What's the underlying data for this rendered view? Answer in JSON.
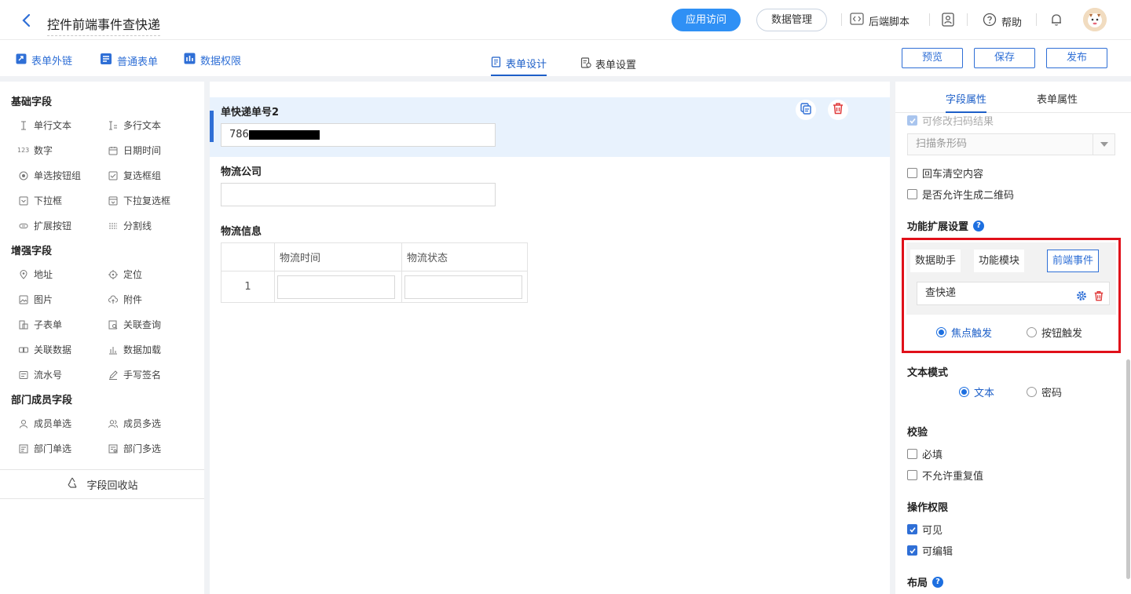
{
  "header": {
    "title": "控件前端事件查快递",
    "app_access_label": "应用访问",
    "data_manage_label": "数据管理",
    "backend_script_label": "后端脚本",
    "help_label": "帮助"
  },
  "subnav": {
    "form_link_label": "表单外链",
    "normal_form_label": "普通表单",
    "data_permission_label": "数据权限",
    "tabs": [
      {
        "label": "表单设计",
        "active": true
      },
      {
        "label": "表单设置",
        "active": false
      }
    ],
    "preview_label": "预览",
    "save_label": "保存",
    "publish_label": "发布"
  },
  "left_panel": {
    "sections": [
      {
        "title": "基础字段",
        "items": [
          {
            "label": "单行文本",
            "icon": "single-text-icon"
          },
          {
            "label": "多行文本",
            "icon": "multi-text-icon"
          },
          {
            "label": "数字",
            "icon": "number-icon"
          },
          {
            "label": "日期时间",
            "icon": "calendar-icon"
          },
          {
            "label": "单选按钮组",
            "icon": "radio-icon"
          },
          {
            "label": "复选框组",
            "icon": "checkbox-icon"
          },
          {
            "label": "下拉框",
            "icon": "dropdown-icon"
          },
          {
            "label": "下拉复选框",
            "icon": "dropdown-multi-icon"
          },
          {
            "label": "扩展按钮",
            "icon": "ext-button-icon"
          },
          {
            "label": "分割线",
            "icon": "divider-icon"
          }
        ]
      },
      {
        "title": "增强字段",
        "items": [
          {
            "label": "地址",
            "icon": "location-pin-icon"
          },
          {
            "label": "定位",
            "icon": "crosshair-icon"
          },
          {
            "label": "图片",
            "icon": "image-icon"
          },
          {
            "label": "附件",
            "icon": "cloud-upload-icon"
          },
          {
            "label": "子表单",
            "icon": "subform-icon"
          },
          {
            "label": "关联查询",
            "icon": "link-query-icon"
          },
          {
            "label": "关联数据",
            "icon": "link-data-icon"
          },
          {
            "label": "数据加载",
            "icon": "bar-chart-icon"
          },
          {
            "label": "流水号",
            "icon": "serial-icon"
          },
          {
            "label": "手写签名",
            "icon": "pen-icon"
          }
        ]
      },
      {
        "title": "部门成员字段",
        "items": [
          {
            "label": "成员单选",
            "icon": "user-icon"
          },
          {
            "label": "成员多选",
            "icon": "users-icon"
          },
          {
            "label": "部门单选",
            "icon": "dept-icon"
          },
          {
            "label": "部门多选",
            "icon": "dept-multi-icon"
          }
        ]
      }
    ],
    "recycle_label": "字段回收站"
  },
  "canvas": {
    "fields": [
      {
        "label": "单快递单号2",
        "value": "786"
      },
      {
        "label": "物流公司",
        "value": ""
      },
      {
        "label": "物流信息"
      }
    ],
    "table": {
      "headers": [
        "",
        "物流时间",
        "物流状态"
      ],
      "rows": [
        {
          "index": "1"
        }
      ]
    }
  },
  "right_panel": {
    "tabs": [
      {
        "label": "字段属性",
        "active": true
      },
      {
        "label": "表单属性",
        "active": false
      }
    ],
    "scan_editable_label": "可修改扫码结果",
    "scan_select_value": "扫描条形码",
    "enter_clear_label": "回车清空内容",
    "allow_qr_label": "是否允许生成二维码",
    "ext_settings_title": "功能扩展设置",
    "ext_tabs": [
      {
        "label": "数据助手",
        "active": false
      },
      {
        "label": "功能模块",
        "active": false
      },
      {
        "label": "前端事件",
        "active": true
      }
    ],
    "ext_event_item": "查快递",
    "trigger_options": [
      {
        "label": "焦点触发",
        "selected": true
      },
      {
        "label": "按钮触发",
        "selected": false
      }
    ],
    "text_mode_title": "文本模式",
    "text_mode_options": [
      {
        "label": "文本",
        "selected": true
      },
      {
        "label": "密码",
        "selected": false
      }
    ],
    "validation_title": "校验",
    "required_label": "必填",
    "no_duplicate_label": "不允许重复值",
    "permission_title": "操作权限",
    "visible_label": "可见",
    "editable_label": "可编辑",
    "layout_title": "布局"
  },
  "colors": {
    "primary": "#2f6fd6",
    "accent_pill": "#2f90f5",
    "highlight_border": "#e0101a",
    "delete_red": "#e03b3b",
    "selected_bg": "#e8f2fd"
  }
}
